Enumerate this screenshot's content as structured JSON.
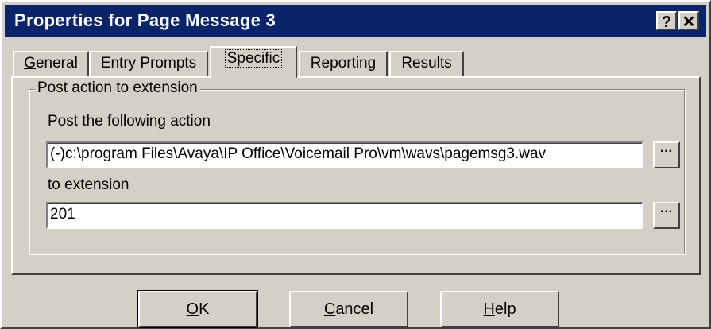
{
  "window": {
    "title": "Properties for Page Message 3",
    "help_button": "?",
    "close_button": "✕"
  },
  "tabs": [
    {
      "label_pre": "",
      "label_u": "G",
      "label_post": "eneral",
      "active": false
    },
    {
      "label_pre": "",
      "label_u": "",
      "label_post": "Entry Prompts",
      "active": false
    },
    {
      "label_pre": "",
      "label_u": "",
      "label_post": "Specific",
      "active": true
    },
    {
      "label_pre": "",
      "label_u": "",
      "label_post": "Reporting",
      "active": false
    },
    {
      "label_pre": "",
      "label_u": "",
      "label_post": "Results",
      "active": false
    }
  ],
  "group": {
    "title": "Post action to extension",
    "action_label": "Post the following action",
    "action_value": "(-)c:\\program Files\\Avaya\\IP Office\\Voicemail Pro\\vm\\wavs\\pagemsg3.wav",
    "extension_label": "to extension",
    "extension_value": "201",
    "browse_label": "···"
  },
  "buttons": {
    "ok_u": "O",
    "ok_rest": "K",
    "cancel_u": "C",
    "cancel_rest": "ancel",
    "help_u": "H",
    "help_rest": "elp"
  }
}
